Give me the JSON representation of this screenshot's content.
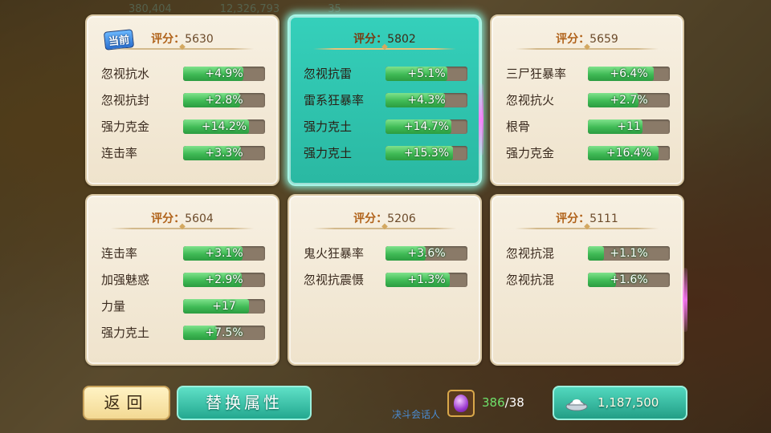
{
  "current_badge": "当前",
  "score_label": "评分：",
  "cards": [
    {
      "score": "5630",
      "current": true,
      "selected": false,
      "attrs": [
        {
          "name": "忽视抗水",
          "value": "+4.9%",
          "fill": 0.74
        },
        {
          "name": "忽视抗封",
          "value": "+2.8%",
          "fill": 0.7
        },
        {
          "name": "强力克金",
          "value": "+14.2%",
          "fill": 0.8
        },
        {
          "name": "连击率",
          "value": "+3.3%",
          "fill": 0.71
        }
      ]
    },
    {
      "score": "5802",
      "current": false,
      "selected": true,
      "attrs": [
        {
          "name": "忽视抗雷",
          "value": "+5.1%",
          "fill": 0.75
        },
        {
          "name": "雷系狂暴率",
          "value": "+4.3%",
          "fill": 0.73
        },
        {
          "name": "强力克土",
          "value": "+14.7%",
          "fill": 0.8
        },
        {
          "name": "强力克土",
          "value": "+15.3%",
          "fill": 0.82
        }
      ]
    },
    {
      "score": "5659",
      "current": false,
      "selected": false,
      "attrs": [
        {
          "name": "三尸狂暴率",
          "value": "+6.4%",
          "fill": 0.8
        },
        {
          "name": "忽视抗火",
          "value": "+2.7%",
          "fill": 0.62
        },
        {
          "name": "根骨",
          "value": "+11",
          "fill": 0.67
        },
        {
          "name": "强力克金",
          "value": "+16.4%",
          "fill": 0.86
        }
      ]
    },
    {
      "score": "5604",
      "current": false,
      "selected": false,
      "attrs": [
        {
          "name": "连击率",
          "value": "+3.1%",
          "fill": 0.73
        },
        {
          "name": "加强魅惑",
          "value": "+2.9%",
          "fill": 0.72
        },
        {
          "name": "力量",
          "value": "+17",
          "fill": 0.8
        },
        {
          "name": "强力克土",
          "value": "+7.5%",
          "fill": 0.41
        }
      ]
    },
    {
      "score": "5206",
      "current": false,
      "selected": false,
      "attrs": [
        {
          "name": "鬼火狂暴率",
          "value": "+3.6%",
          "fill": 0.49
        },
        {
          "name": "忽视抗震慑",
          "value": "+1.3%",
          "fill": 0.78
        }
      ]
    },
    {
      "score": "5111",
      "current": false,
      "selected": false,
      "attrs": [
        {
          "name": "忽视抗混",
          "value": "+1.1%",
          "fill": 0.2
        },
        {
          "name": "忽视抗混",
          "value": "+1.6%",
          "fill": 0.34
        }
      ]
    }
  ],
  "buttons": {
    "back": "返回",
    "replace": "替换属性"
  },
  "gem": {
    "have": "386",
    "need": "/38"
  },
  "silver": "1,187,500",
  "topbar": [
    "380,404",
    "12,326,793",
    "35"
  ],
  "background_text": "决斗会话人"
}
